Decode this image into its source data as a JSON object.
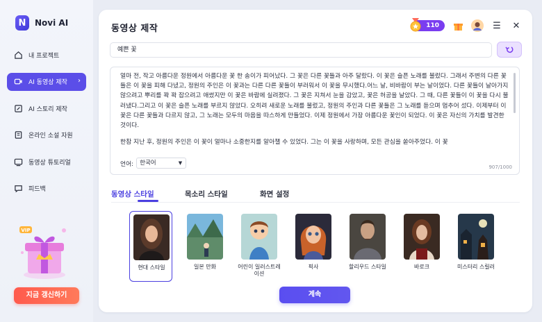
{
  "app": {
    "name": "Novi AI"
  },
  "sidebar": {
    "items": [
      {
        "label": "내 프로젝트",
        "icon": "home-icon"
      },
      {
        "label": "AI 동영상 제작",
        "icon": "video-icon",
        "active": true
      },
      {
        "label": "AI 스토리 제작",
        "icon": "edit-icon"
      },
      {
        "label": "온라인 소설 자원",
        "icon": "book-icon"
      },
      {
        "label": "동영상 튜토리얼",
        "icon": "tutorial-icon"
      },
      {
        "label": "피드백",
        "icon": "feedback-icon"
      }
    ],
    "upgrade_label": "지금 갱신하기",
    "promo_badge": "VIP"
  },
  "header": {
    "title": "동영상 제작",
    "points": "110"
  },
  "title_input": {
    "value": "예쁜 꽃"
  },
  "story": {
    "paragraphs": [
      "얼마 전, 작고 아름다운 정원에서 아름다운 꽃 한 송이가 피어났다. 그 꽃은 다른 꽃들과 아주 달랐다. 이 꽃은 슬픈 노래를 불렀다. 그래서 주변의 다른 꽃들은 이 꽃을 피해 다녔고, 정원의 주인은 이 꽃과는 다른 다른 꽃들이 부러워서 이 꽃을 무시했다.어느 날, 비바람이 부는 날이었다. 다른 꽃들이 날아가지 않으려고 뿌리를 꽉 꽉 잡으려고 애썼지만 이 꽃은 바람에 실려졌다. 그 꽃은 지쳐서 눈을 감았고, 꽃은 허공을 날았다. 그 때, 다른 꽃들이 이 꽃을 다시 불러냈다.그리고 이 꽃은 슬픈 노래를 부르지 않았다. 오히려 새로운 노래를 불렀고, 정원의 주인과 다른 꽃들은 그 노래를 듣으며 멈추어 섰다. 이제부터 이 꽃은 다른 꽃들과 다르지 않고, 그 노래는 모두의 마음을 따스하게 만들었다. 이제 정원에서 가장 아름다운 꽃인이 되었다. 이 꽃은 자신의 가치를 발견한 것이다.",
      "한참 지난 후, 정원의 주인은 이 꽃이 얼마나 소중한지를 알아챌 수 있었다. 그는 이 꽃을 사랑하며, 모든 관심을 쏟아주었다. 이 꽃"
    ],
    "language_label": "언어:",
    "language_value": "한국어",
    "counter": "907/1000"
  },
  "tabs": [
    {
      "label": "동영상 스타일",
      "active": true
    },
    {
      "label": "목소리 스타일"
    },
    {
      "label": "화면 설정"
    }
  ],
  "styles": [
    {
      "label": "현대 스타일",
      "selected": true
    },
    {
      "label": "일본 만화"
    },
    {
      "label": "어린이 일러스트레이션"
    },
    {
      "label": "픽사"
    },
    {
      "label": "할리우드 스타일"
    },
    {
      "label": "바로크"
    },
    {
      "label": "미스터리 스릴러"
    }
  ],
  "continue_label": "계속",
  "colors": {
    "accent": "#5b4ee8",
    "upgrade": "#ff5a4d",
    "points": "#7a3df0"
  }
}
